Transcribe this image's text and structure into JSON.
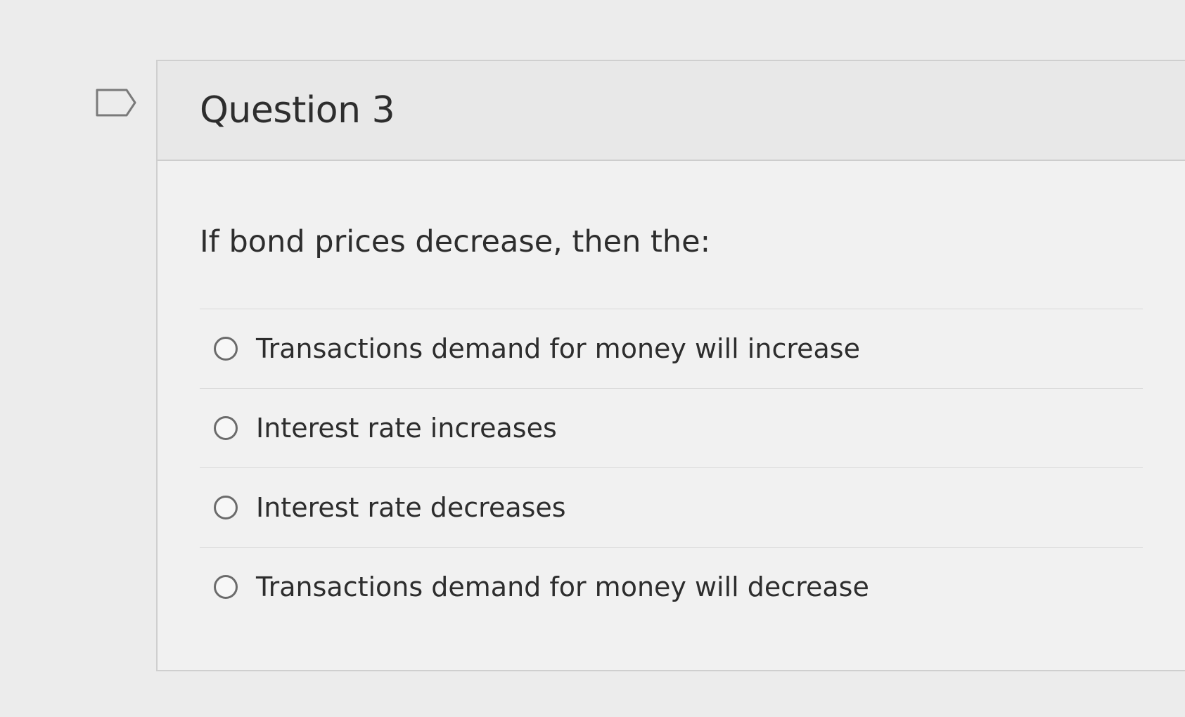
{
  "question": {
    "title": "Question 3",
    "prompt": "If bond prices decrease, then the:",
    "flag_icon": "flag-icon"
  },
  "answers": [
    {
      "label": "Transactions demand for money will increase"
    },
    {
      "label": "Interest rate increases"
    },
    {
      "label": "Interest rate decreases"
    },
    {
      "label": "Transactions demand for money will decrease"
    }
  ],
  "colors": {
    "background": "#ececec",
    "card": "#f1f1f1",
    "header": "#e8e8e8",
    "text": "#2d2d2d",
    "border": "#cfcfcf"
  }
}
